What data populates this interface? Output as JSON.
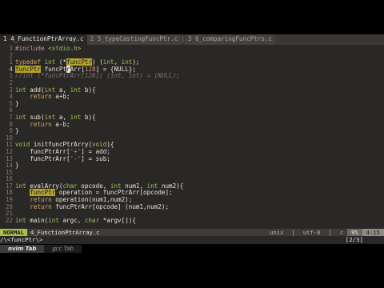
{
  "tabline": {
    "tabs": [
      {
        "label": "1 4_FunctionPtrArray.c",
        "active": true
      },
      {
        "label": "2 5_typeCastingFuncPtr.c",
        "active": false
      },
      {
        "label": "3 6_comparingFuncPtrs.c",
        "active": false
      }
    ],
    "separator": "|"
  },
  "lines": [
    {
      "n": "3",
      "segs": [
        [
          "pp",
          "#include"
        ],
        [
          "tx",
          " "
        ],
        [
          "st",
          "<stdio.h>"
        ]
      ]
    },
    {
      "n": "2",
      "segs": []
    },
    {
      "n": "1",
      "segs": [
        [
          "kw",
          "typedef"
        ],
        [
          "tx",
          " "
        ],
        [
          "ty",
          "int"
        ],
        [
          "tx",
          " (*"
        ],
        [
          "hl",
          "funcPtr"
        ],
        [
          "tx",
          ") ("
        ],
        [
          "ty",
          "int"
        ],
        [
          "tx",
          ", "
        ],
        [
          "ty",
          "int"
        ],
        [
          "tx",
          ");"
        ]
      ]
    },
    {
      "n": "4",
      "cur": true,
      "segs": [
        [
          "hl",
          "funcPtr"
        ],
        [
          "tx",
          " funcPt"
        ],
        [
          "cursor",
          "r"
        ],
        [
          "tx",
          "Arr["
        ],
        [
          "nm",
          "128"
        ],
        [
          "tx",
          "] = {NULL};"
        ]
      ]
    },
    {
      "n": "1",
      "segs": [
        [
          "cm",
          "//int (*funcPtrArr[128]) (int, int) = (NULL);"
        ]
      ]
    },
    {
      "n": "2",
      "segs": []
    },
    {
      "n": "3",
      "segs": [
        [
          "ty",
          "int"
        ],
        [
          "tx",
          " add("
        ],
        [
          "ty",
          "int"
        ],
        [
          "tx",
          " a, "
        ],
        [
          "ty",
          "int"
        ],
        [
          "tx",
          " b){"
        ]
      ]
    },
    {
      "n": "4",
      "segs": [
        [
          "tx",
          "    "
        ],
        [
          "kw",
          "return"
        ],
        [
          "tx",
          " a+b;"
        ]
      ]
    },
    {
      "n": "5",
      "segs": [
        [
          "tx",
          "}"
        ]
      ]
    },
    {
      "n": "6",
      "segs": []
    },
    {
      "n": "7",
      "segs": [
        [
          "ty",
          "int"
        ],
        [
          "tx",
          " sub("
        ],
        [
          "ty",
          "int"
        ],
        [
          "tx",
          " a, "
        ],
        [
          "ty",
          "int"
        ],
        [
          "tx",
          " b){"
        ]
      ]
    },
    {
      "n": "8",
      "segs": [
        [
          "tx",
          "    "
        ],
        [
          "kw",
          "return"
        ],
        [
          "tx",
          " a-b;"
        ]
      ]
    },
    {
      "n": "9",
      "segs": [
        [
          "tx",
          "}"
        ]
      ]
    },
    {
      "n": "10",
      "segs": []
    },
    {
      "n": "11",
      "segs": [
        [
          "ty",
          "void"
        ],
        [
          "tx",
          " initfuncPtrArry("
        ],
        [
          "ty",
          "void"
        ],
        [
          "tx",
          "){"
        ]
      ]
    },
    {
      "n": "12",
      "segs": [
        [
          "tx",
          "    funcPtrArr["
        ],
        [
          "nm",
          "'+'"
        ],
        [
          "tx",
          "] = add;"
        ]
      ]
    },
    {
      "n": "13",
      "segs": [
        [
          "tx",
          "    funcPtrArr["
        ],
        [
          "nm",
          "'-'"
        ],
        [
          "tx",
          "] = sub;"
        ]
      ]
    },
    {
      "n": "14",
      "segs": [
        [
          "tx",
          "}"
        ]
      ]
    },
    {
      "n": "15",
      "segs": []
    },
    {
      "n": "16",
      "segs": []
    },
    {
      "n": "17",
      "segs": [
        [
          "ty",
          "int"
        ],
        [
          "tx",
          " evalArry("
        ],
        [
          "ty",
          "char"
        ],
        [
          "tx",
          " opcode, "
        ],
        [
          "ty",
          "int"
        ],
        [
          "tx",
          " num1, "
        ],
        [
          "ty",
          "int"
        ],
        [
          "tx",
          " num2){"
        ]
      ]
    },
    {
      "n": "18",
      "segs": [
        [
          "tx",
          "    "
        ],
        [
          "hl",
          "funcPtr"
        ],
        [
          "tx",
          " operation = funcPtrArr[opcode];"
        ]
      ]
    },
    {
      "n": "19",
      "segs": [
        [
          "tx",
          "    "
        ],
        [
          "kw",
          "return"
        ],
        [
          "tx",
          " operation(num1,num2);"
        ]
      ]
    },
    {
      "n": "20",
      "segs": [
        [
          "tx",
          "    "
        ],
        [
          "kw",
          "return"
        ],
        [
          "tx",
          " funcPtrArr[opcode] (num1,num2);"
        ]
      ]
    },
    {
      "n": "21",
      "segs": []
    },
    {
      "n": "22",
      "segs": [
        [
          "ty",
          "int"
        ],
        [
          "tx",
          " main("
        ],
        [
          "ty",
          "int"
        ],
        [
          "tx",
          " argc, "
        ],
        [
          "ty",
          "char"
        ],
        [
          "tx",
          " *argv[]){"
        ]
      ]
    }
  ],
  "statusline": {
    "mode": "NORMAL",
    "filename": "4_FunctionPtrArray.c",
    "fileformat": "unix",
    "encoding": "utf-8",
    "filetype": "c",
    "percent": "9%",
    "position": "4:15",
    "sep": "|"
  },
  "cmdline": {
    "text": "/\\<funcPtr\\>",
    "search_count": "[2/3]"
  },
  "terminal_tabs": [
    {
      "label": "nvim Tab",
      "active": true
    },
    {
      "label": "gcc Tab",
      "active": false
    }
  ],
  "colors": {
    "background": "#2a2826",
    "highlight": "#b5a32c",
    "mode_bg": "#a7c046"
  }
}
